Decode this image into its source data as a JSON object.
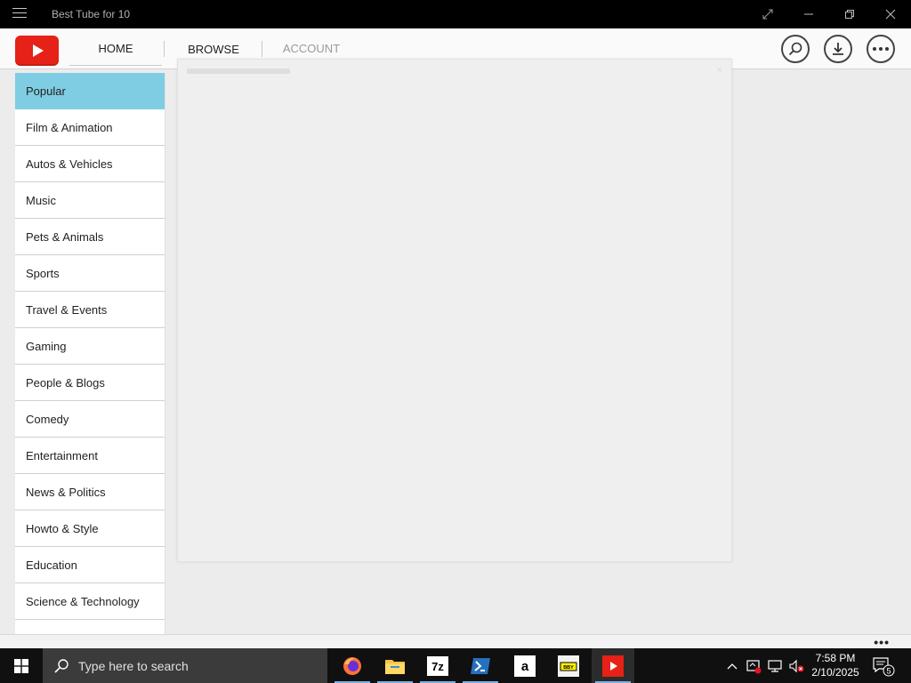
{
  "window": {
    "title": "Best Tube for 10"
  },
  "header": {
    "tabs": [
      {
        "label": "HOME"
      },
      {
        "label": "BROWSE"
      },
      {
        "label": "ACCOUNT"
      }
    ],
    "accent_color": "#e62117"
  },
  "sidebar": {
    "items": [
      {
        "label": "Popular",
        "active": true
      },
      {
        "label": "Film & Animation"
      },
      {
        "label": "Autos & Vehicles"
      },
      {
        "label": "Music"
      },
      {
        "label": "Pets & Animals"
      },
      {
        "label": "Sports"
      },
      {
        "label": "Travel & Events"
      },
      {
        "label": "Gaming"
      },
      {
        "label": "People & Blogs"
      },
      {
        "label": "Comedy"
      },
      {
        "label": "Entertainment"
      },
      {
        "label": "News & Politics"
      },
      {
        "label": "Howto & Style"
      },
      {
        "label": "Education"
      },
      {
        "label": "Science & Technology"
      }
    ],
    "active_color": "#7fcde3"
  },
  "panel": {
    "close_glyph": "×"
  },
  "appbar": {
    "more": "•••"
  },
  "taskbar": {
    "search_placeholder": "Type here to search",
    "apps": [
      "firefox-icon",
      "file-explorer-icon",
      "7zip-icon",
      "powershell-icon",
      "amazon-icon",
      "bestbuy-icon",
      "best-tube-icon"
    ],
    "app_labels": {
      "sevenzip": "7z",
      "amazon": "a",
      "bestbuy": "BBY"
    },
    "clock_time": "7:58 PM",
    "clock_date": "2/10/2025",
    "notification_count": "5"
  }
}
